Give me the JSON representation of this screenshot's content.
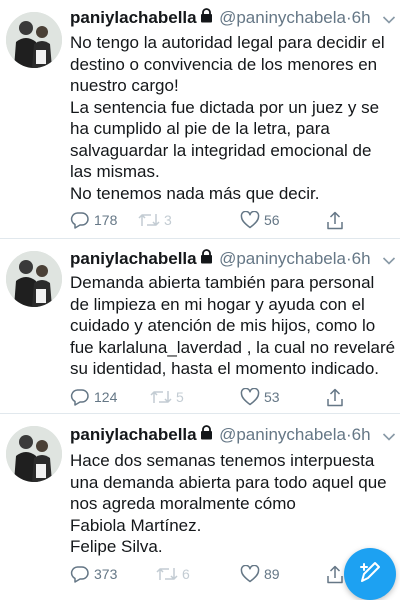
{
  "tweets": [
    {
      "name": "paniylachabella",
      "handle": "@paninychabela",
      "separator": "·",
      "time": "6h",
      "lines": [
        "No tengo la autoridad legal para decidir el",
        "destino o convivencia de los menores en",
        "nuestro cargo!",
        "La sentencia fue dictada por un juez  y se",
        "ha cumplido al pie de la letra, para",
        "salvaguardar la integridad emocional de",
        "las mismas.",
        "No tenemos nada más que decir."
      ],
      "replies": "178",
      "retweets": "3",
      "likes": "56"
    },
    {
      "name": "paniylachabella",
      "handle": "@paninychabela",
      "separator": "·",
      "time": "6h",
      "lines": [
        "Demanda abierta también para personal",
        "de limpieza en mi hogar y ayuda con el",
        "cuidado y atención de mis hijos, como lo",
        "fue karlaluna_laverdad , la cual no revelaré",
        "su identidad, hasta el momento indicado."
      ],
      "replies": "124",
      "retweets": "5",
      "likes": "53"
    },
    {
      "name": "paniylachabella",
      "handle": "@paninychabela",
      "separator": "·",
      "time": "6h",
      "lines": [
        "Hace dos semanas tenemos interpuesta",
        "una demanda abierta para todo aquel que",
        "nos agreda moralmente cómo",
        "Fabiola Martínez.",
        "Felipe Silva."
      ],
      "replies": "373",
      "retweets": "6",
      "likes": "89"
    }
  ],
  "icons": {
    "lock": "lock-icon",
    "caret": "chevron-down-icon",
    "reply": "reply-icon",
    "retweet": "retweet-icon",
    "like": "heart-icon",
    "share": "share-icon",
    "compose": "compose-tweet-icon"
  },
  "colors": {
    "accent": "#1da1f2",
    "secondary_text": "#657786",
    "disabled": "#c3ccd3",
    "divider": "#e1e8ed"
  }
}
